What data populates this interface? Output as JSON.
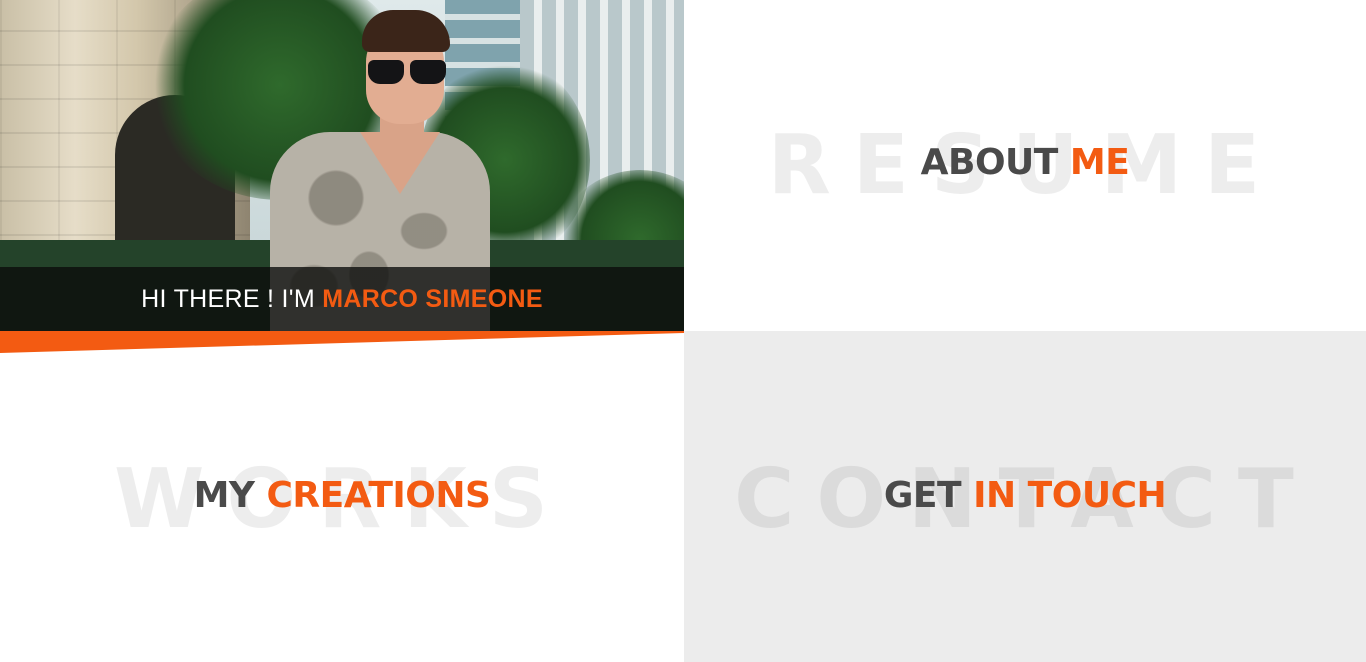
{
  "hero": {
    "greeting": "HI THERE ! I'M",
    "name": "MARCO SIMEONE"
  },
  "sections": {
    "about": {
      "watermark": "RESUME",
      "title_dark": "ABOUT",
      "title_accent": "ME"
    },
    "works": {
      "watermark": "WORKS",
      "title_dark": "MY",
      "title_accent": "CREATIONS"
    },
    "contact": {
      "watermark": "CONTACT",
      "title_dark": "GET",
      "title_accent": "IN TOUCH"
    }
  },
  "colors": {
    "accent": "#f35b12",
    "title_dark": "#4a4a4a",
    "contact_bg": "#ececec"
  }
}
